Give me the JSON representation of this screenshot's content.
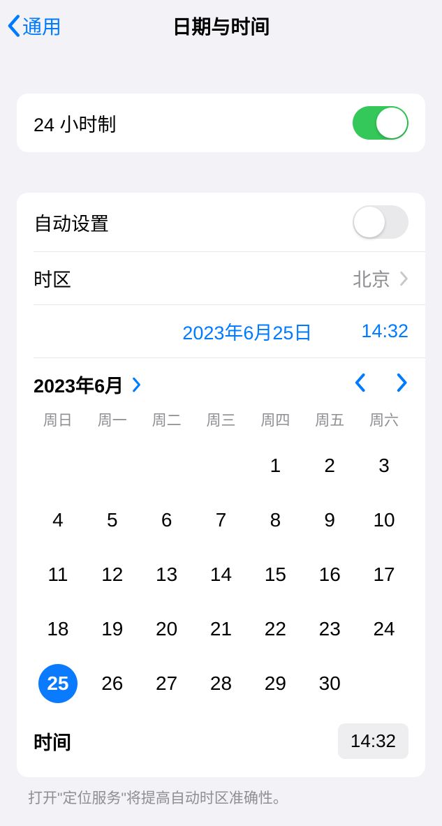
{
  "header": {
    "back": "通用",
    "title": "日期与时间"
  },
  "rows": {
    "twentyFourHour": {
      "label": "24 小时制",
      "on": true
    },
    "autoSet": {
      "label": "自动设置",
      "on": false
    },
    "timezone": {
      "label": "时区",
      "value": "北京"
    },
    "dateValue": "2023年6月25日",
    "timeValue": "14:32"
  },
  "calendar": {
    "month": "2023年6月",
    "weekdays": [
      "周日",
      "周一",
      "周二",
      "周三",
      "周四",
      "周五",
      "周六"
    ],
    "startOffset": 4,
    "daysInMonth": 30,
    "selected": 25
  },
  "timeRow": {
    "label": "时间",
    "value": "14:32"
  },
  "footnote": "打开\"定位服务\"将提高自动时区准确性。"
}
